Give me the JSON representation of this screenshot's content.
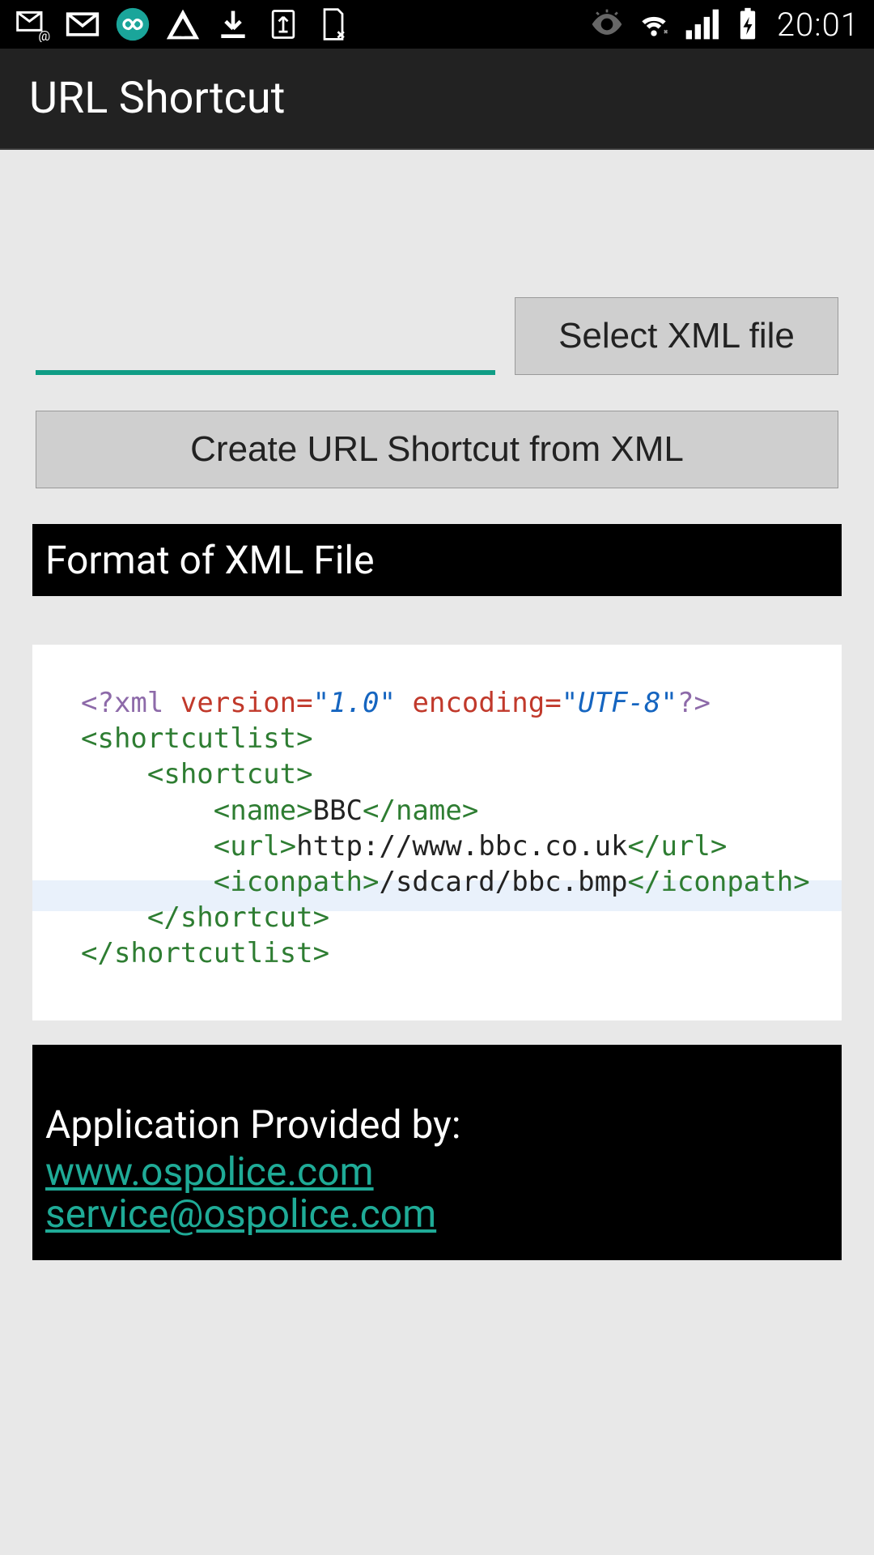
{
  "status": {
    "time": "20:01"
  },
  "header": {
    "title": "URL Shortcut"
  },
  "main": {
    "input_value": "",
    "select_button": "Select XML file",
    "create_button": "Create URL Shortcut from XML"
  },
  "sections": {
    "format_title": "Format of XML File"
  },
  "xml_example": {
    "declaration_prefix": "<?xml",
    "version_attr": "version=",
    "version_val": "\"1.0\"",
    "encoding_attr": "encoding=",
    "encoding_val": "\"UTF-8\"",
    "declaration_suffix": "?>",
    "root_open": "<shortcutlist>",
    "item_open": "<shortcut>",
    "name_open": "<name>",
    "name_text": "BBC",
    "name_close": "</name>",
    "url_open": "<url>",
    "url_text": "http://www.bbc.co.uk",
    "url_close": "</url>",
    "icon_open": "<iconpath>",
    "icon_text": "/sdcard/bbc.bmp",
    "icon_close": "</iconpath>",
    "item_close": "</shortcut>",
    "root_close": "</shortcutlist>"
  },
  "footer": {
    "provided_by": "Application Provided by:",
    "website": "www.ospolice.com",
    "email": "service@ospolice.com"
  }
}
